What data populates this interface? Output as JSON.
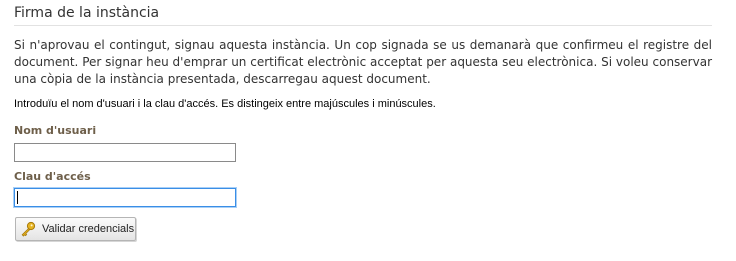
{
  "section": {
    "title": "Firma de la instància"
  },
  "intro_text": "Si n'aprovau el contingut, signau aquesta instància. Un cop signada se us demanarà que confirmeu el registre del document. Per signar heu d'emprar un certificat electrònic acceptat per aquesta seu electrònica. Si voleu conservar una còpia de la instància presentada, descarregau aquest document.",
  "instructions": "Introduïu el nom d'usuari i la clau d'accés. Es distingeix entre majúscules i minúscules.",
  "form": {
    "username": {
      "label": "Nom d'usuari",
      "value": ""
    },
    "password": {
      "label": "Clau d'accés",
      "value": ""
    },
    "submit": {
      "label": "Validar credencials",
      "icon": "key-icon"
    }
  },
  "colors": {
    "label": "#6e5f4a",
    "focus_border": "#3a8ee6",
    "rule": "#e2e2e2",
    "key_icon": "#e6b422"
  }
}
